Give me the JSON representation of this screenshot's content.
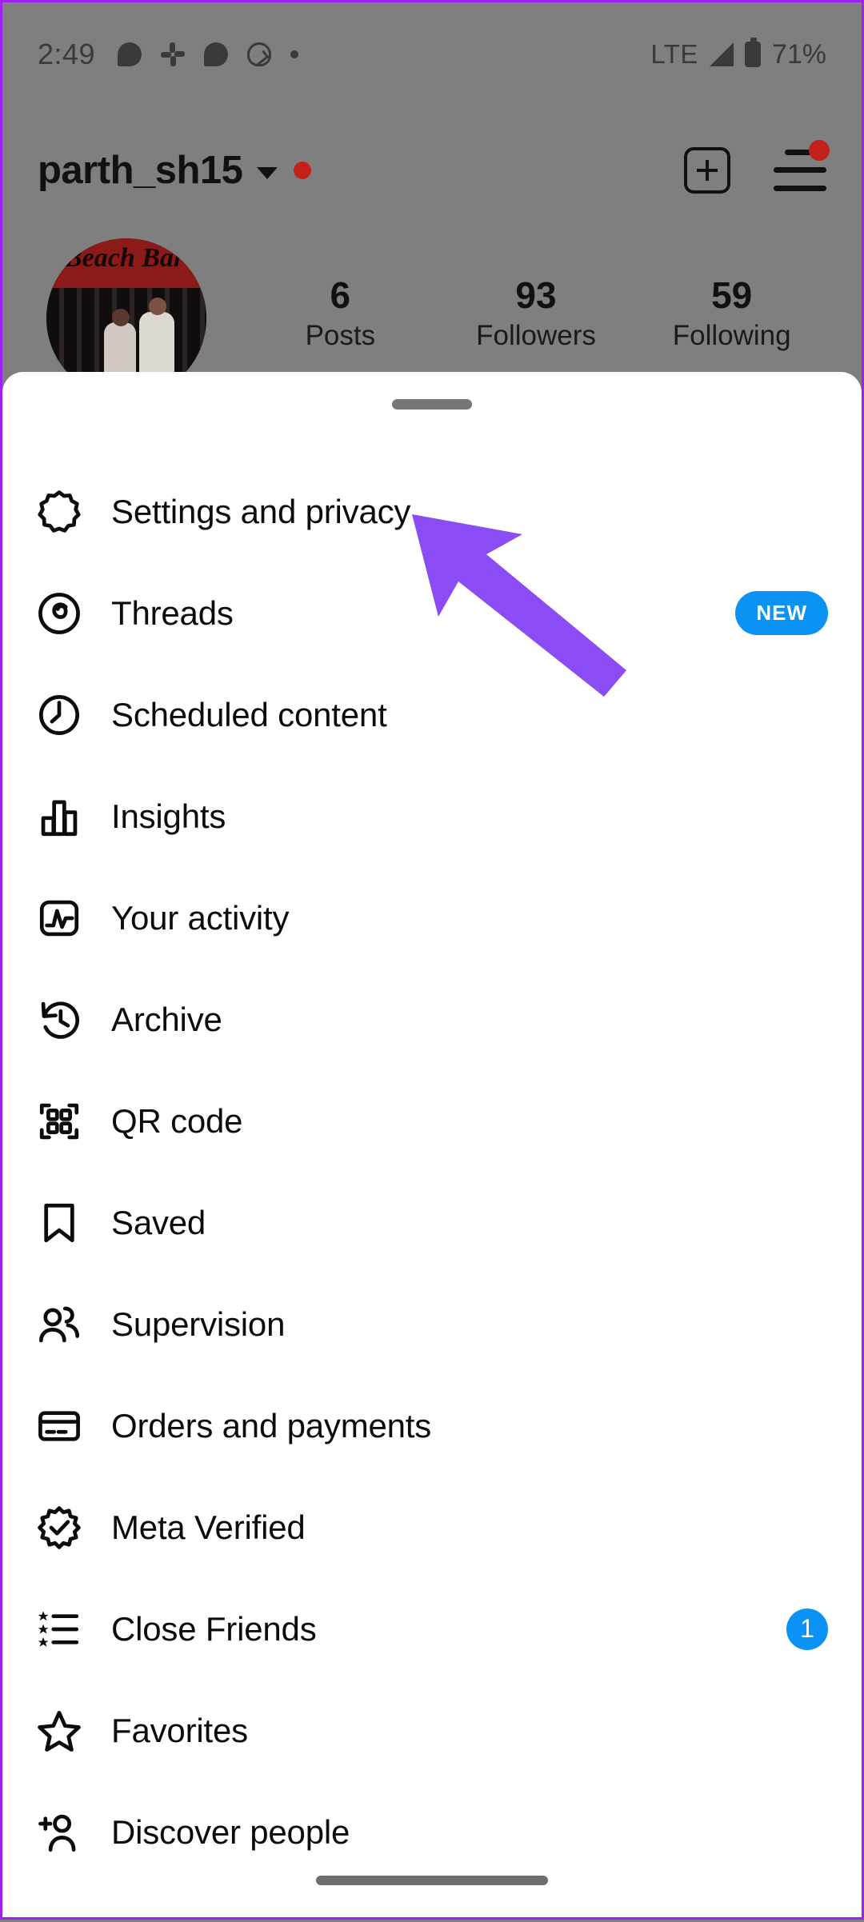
{
  "status_bar": {
    "time": "2:49",
    "left_icons": [
      "chat-bubble-icon",
      "slack-icon",
      "chat-bubble-icon",
      "fitness-egg-icon",
      "dot-icon"
    ],
    "network": "LTE",
    "signal_icon": "signal-triangle-icon",
    "battery_icon": "battery-icon",
    "battery_percent": "71%"
  },
  "profile": {
    "username": "parth_sh15",
    "account_switch_icon": "chevron-down-icon",
    "unread_dot": "red-dot-icon",
    "create_icon": "plus-square-icon",
    "menu_icon": "hamburger-menu-icon",
    "avatar": "profile-avatar",
    "stats": [
      {
        "count": "6",
        "label": "Posts"
      },
      {
        "count": "93",
        "label": "Followers"
      },
      {
        "count": "59",
        "label": "Following"
      }
    ]
  },
  "sheet": {
    "handle": "drag-handle",
    "items": [
      {
        "id": "settings-and-privacy",
        "label": "Settings and privacy",
        "icon": "gear-icon",
        "badge": null,
        "badge_type": null
      },
      {
        "id": "threads",
        "label": "Threads",
        "icon": "threads-icon",
        "badge": "NEW",
        "badge_type": "pill"
      },
      {
        "id": "scheduled-content",
        "label": "Scheduled content",
        "icon": "clock-icon",
        "badge": null,
        "badge_type": null
      },
      {
        "id": "insights",
        "label": "Insights",
        "icon": "bar-chart-icon",
        "badge": null,
        "badge_type": null
      },
      {
        "id": "your-activity",
        "label": "Your activity",
        "icon": "activity-pulse-icon",
        "badge": null,
        "badge_type": null
      },
      {
        "id": "archive",
        "label": "Archive",
        "icon": "archive-clock-icon",
        "badge": null,
        "badge_type": null
      },
      {
        "id": "qr-code",
        "label": "QR code",
        "icon": "qr-code-icon",
        "badge": null,
        "badge_type": null
      },
      {
        "id": "saved",
        "label": "Saved",
        "icon": "bookmark-icon",
        "badge": null,
        "badge_type": null
      },
      {
        "id": "supervision",
        "label": "Supervision",
        "icon": "people-icon",
        "badge": null,
        "badge_type": null
      },
      {
        "id": "orders-and-payments",
        "label": "Orders and payments",
        "icon": "credit-card-icon",
        "badge": null,
        "badge_type": null
      },
      {
        "id": "meta-verified",
        "label": "Meta Verified",
        "icon": "verified-badge-icon",
        "badge": null,
        "badge_type": null
      },
      {
        "id": "close-friends",
        "label": "Close Friends",
        "icon": "star-list-icon",
        "badge": "1",
        "badge_type": "count"
      },
      {
        "id": "favorites",
        "label": "Favorites",
        "icon": "star-icon",
        "badge": null,
        "badge_type": null
      },
      {
        "id": "discover-people",
        "label": "Discover people",
        "icon": "person-add-icon",
        "badge": null,
        "badge_type": null
      }
    ]
  },
  "annotation": {
    "arrow_color": "#8B4BF5",
    "points_to": "settings-and-privacy"
  },
  "colors": {
    "accent_blue": "#0A93F5",
    "red_dot": "#c4201c",
    "sheet_bg": "#ffffff",
    "scrim": "#7f7f7f"
  },
  "system_nav": {
    "pill": "home-indicator"
  }
}
